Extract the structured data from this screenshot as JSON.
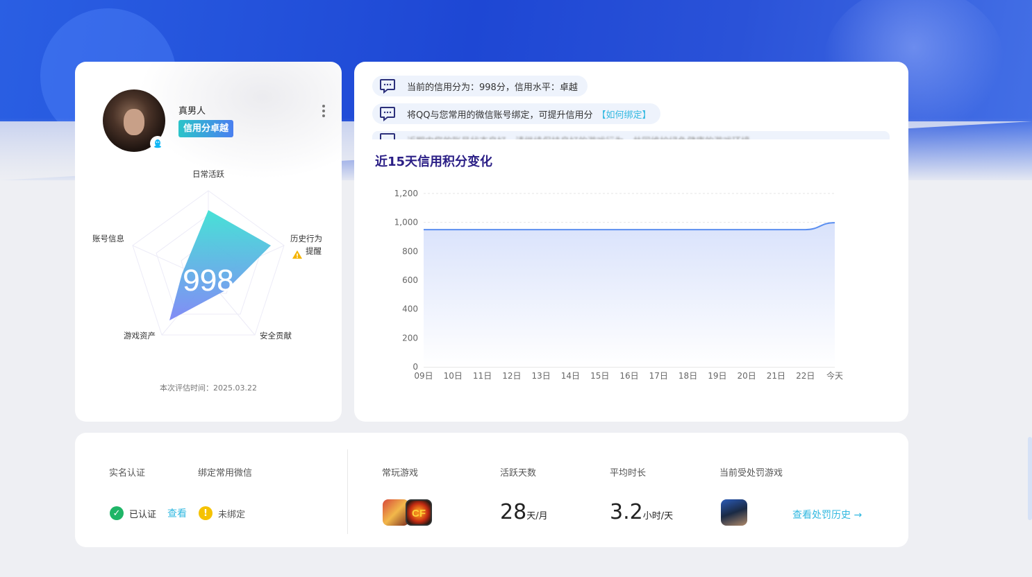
{
  "profile": {
    "username": "真男人",
    "credit_tag": "信用分卓越",
    "score": "998",
    "axes": {
      "top": "日常活跃",
      "right": "历史行为",
      "right_sub": "提醒",
      "bottom_right": "安全贡献",
      "bottom_left": "游戏资产",
      "left": "账号信息"
    },
    "eval_time": "本次评估时间：2025.03.22"
  },
  "notices": [
    {
      "text": "当前的信用分为：998分，信用水平：卓越"
    },
    {
      "text": "将QQ与您常用的微信账号绑定，可提升信用分",
      "link": "【如何绑定】"
    },
    {
      "text": "近期内您的账号状态良好，请继续保持良好的游戏行为，共同维护绿色健康的游戏环境"
    }
  ],
  "chart_title": "近15天信用积分变化",
  "chart_data": {
    "type": "area",
    "categories": [
      "09日",
      "10日",
      "11日",
      "12日",
      "13日",
      "14日",
      "15日",
      "16日",
      "17日",
      "18日",
      "19日",
      "20日",
      "21日",
      "22日",
      "今天"
    ],
    "values": [
      950,
      950,
      950,
      950,
      950,
      950,
      950,
      950,
      950,
      950,
      950,
      950,
      950,
      950,
      998
    ],
    "ylim": [
      0,
      1200
    ],
    "yticks": [
      "0",
      "200",
      "400",
      "600",
      "800",
      "1,000",
      "1,200"
    ],
    "color": "#5b8ff0"
  },
  "bottom": {
    "realname_label": "实名认证",
    "wechat_label": "绑定常用微信",
    "realname_status": "已认证",
    "realname_view": "查看",
    "wechat_status": "未绑定",
    "games_label": "常玩游戏",
    "active_label": "活跃天数",
    "active_value": "28",
    "active_unit": "天/月",
    "duration_label": "平均时长",
    "duration_value": "3.2",
    "duration_unit": "小时/天",
    "penalty_label": "当前受处罚游戏",
    "history_link": "查看处罚历史 →"
  },
  "colors": {
    "accent": "#31b8e0",
    "title": "#2b1f86",
    "ok": "#1fb567",
    "warn": "#f5c200"
  }
}
